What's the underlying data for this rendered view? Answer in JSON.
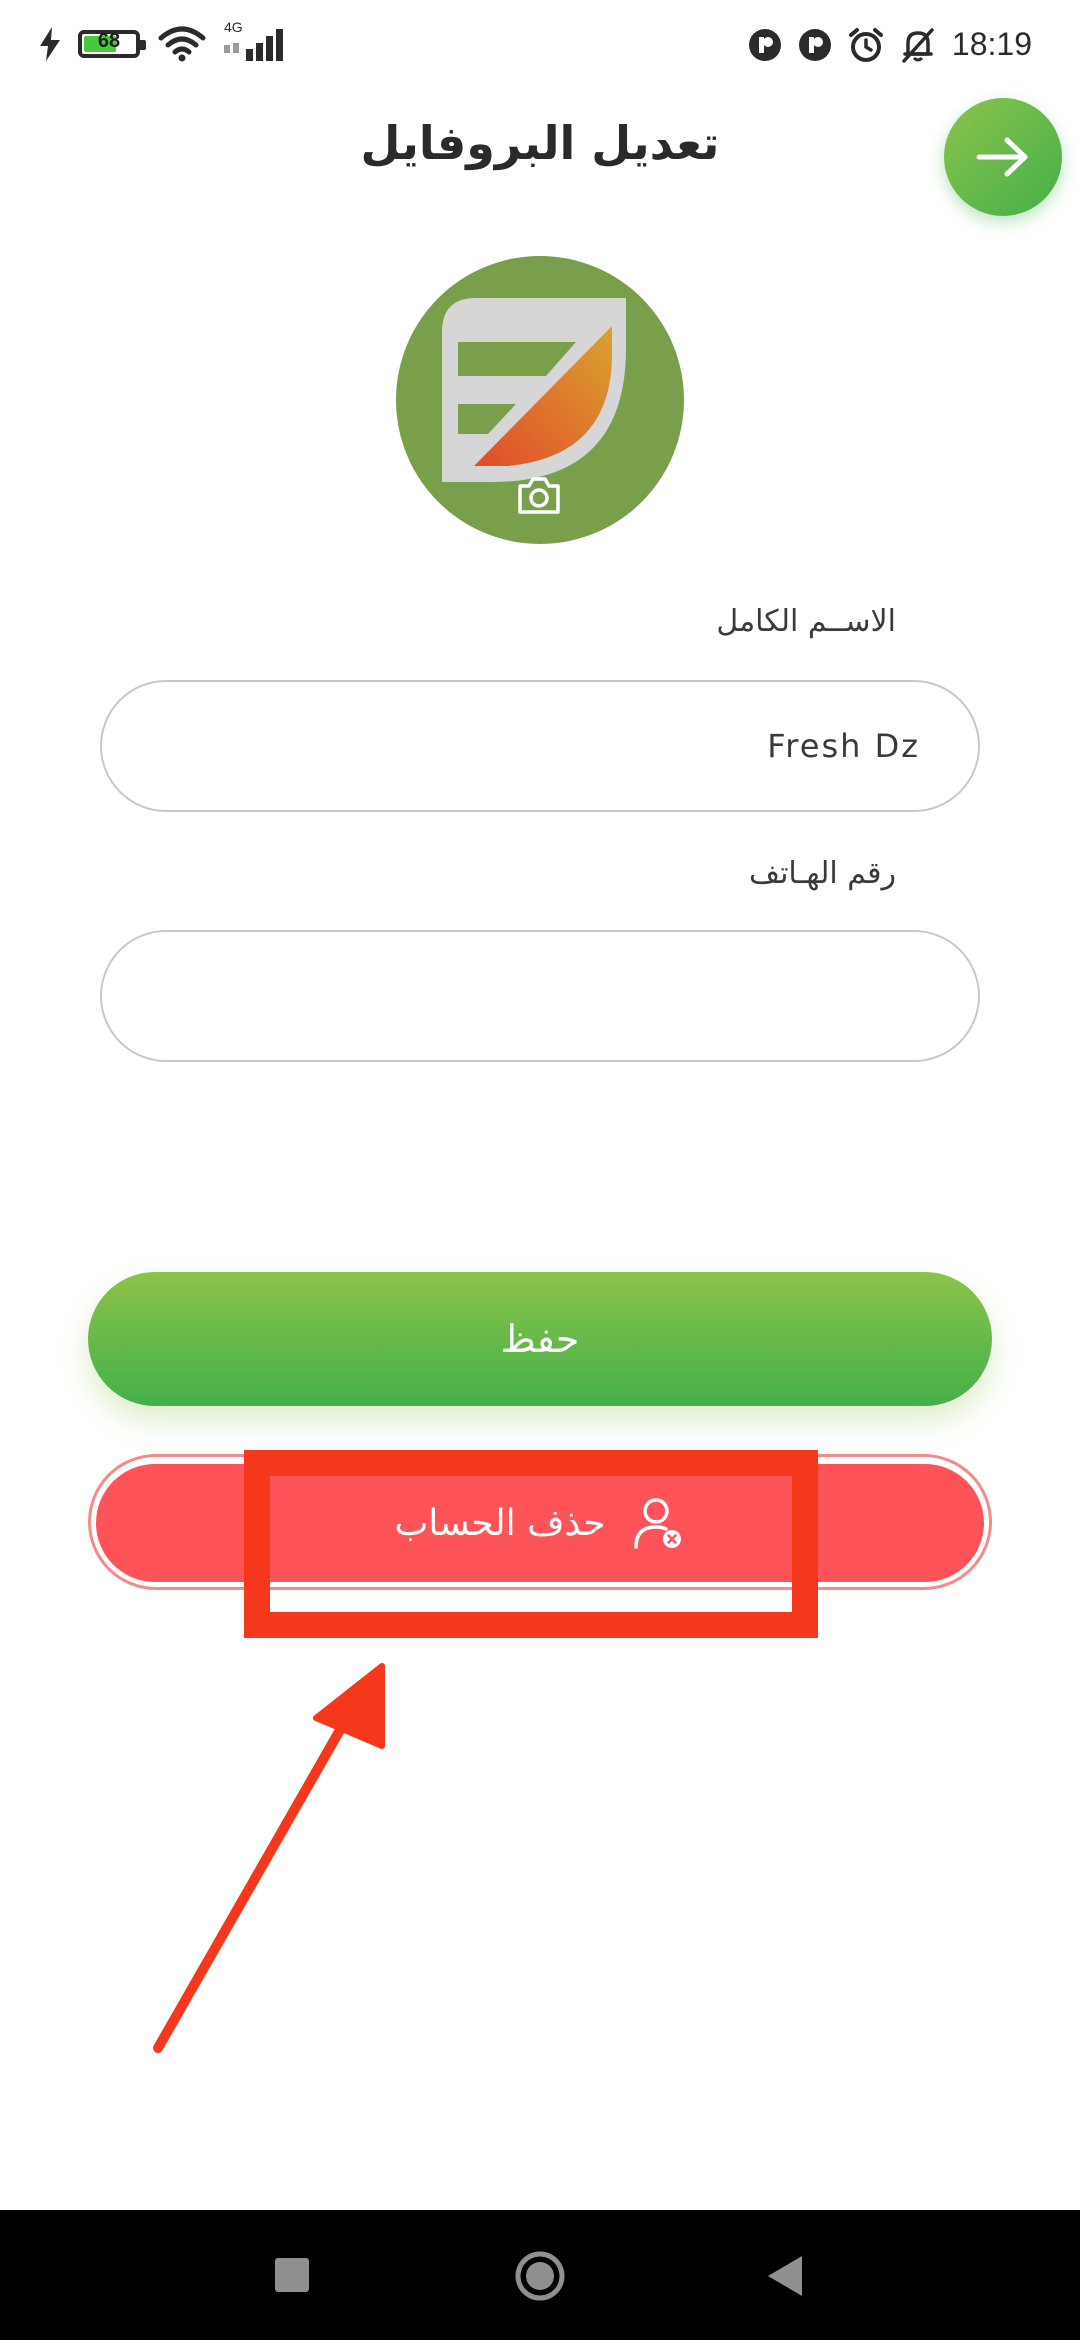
{
  "status_bar": {
    "battery_percent": "68",
    "network_type": "4G",
    "time": "18:19",
    "icons": [
      "charging-icon",
      "battery-icon",
      "wifi-icon",
      "signal-icon",
      "app-notification-icon",
      "app-notification-icon",
      "alarm-icon",
      "muted-bell-icon"
    ]
  },
  "header": {
    "title": "تعديل البروفايل",
    "back_icon": "arrow-right-icon"
  },
  "avatar": {
    "logo_icon": "leaf-logo-icon",
    "camera_icon": "camera-icon"
  },
  "form": {
    "name_label": "الاســم الكامل",
    "name_value": "Fresh Dz",
    "phone_label": "رقم الهـاتف",
    "phone_value": ""
  },
  "buttons": {
    "save_label": "حفظ",
    "delete_label": "حذف الحساب",
    "delete_icon": "remove-user-icon"
  },
  "colors": {
    "green_start": "#8cc34a",
    "green_end": "#43b049",
    "delete_red": "#ff535a",
    "annotation_red": "#f5371b"
  },
  "nav_bar": {
    "icons": [
      "recent-apps-icon",
      "home-icon",
      "back-icon"
    ]
  }
}
